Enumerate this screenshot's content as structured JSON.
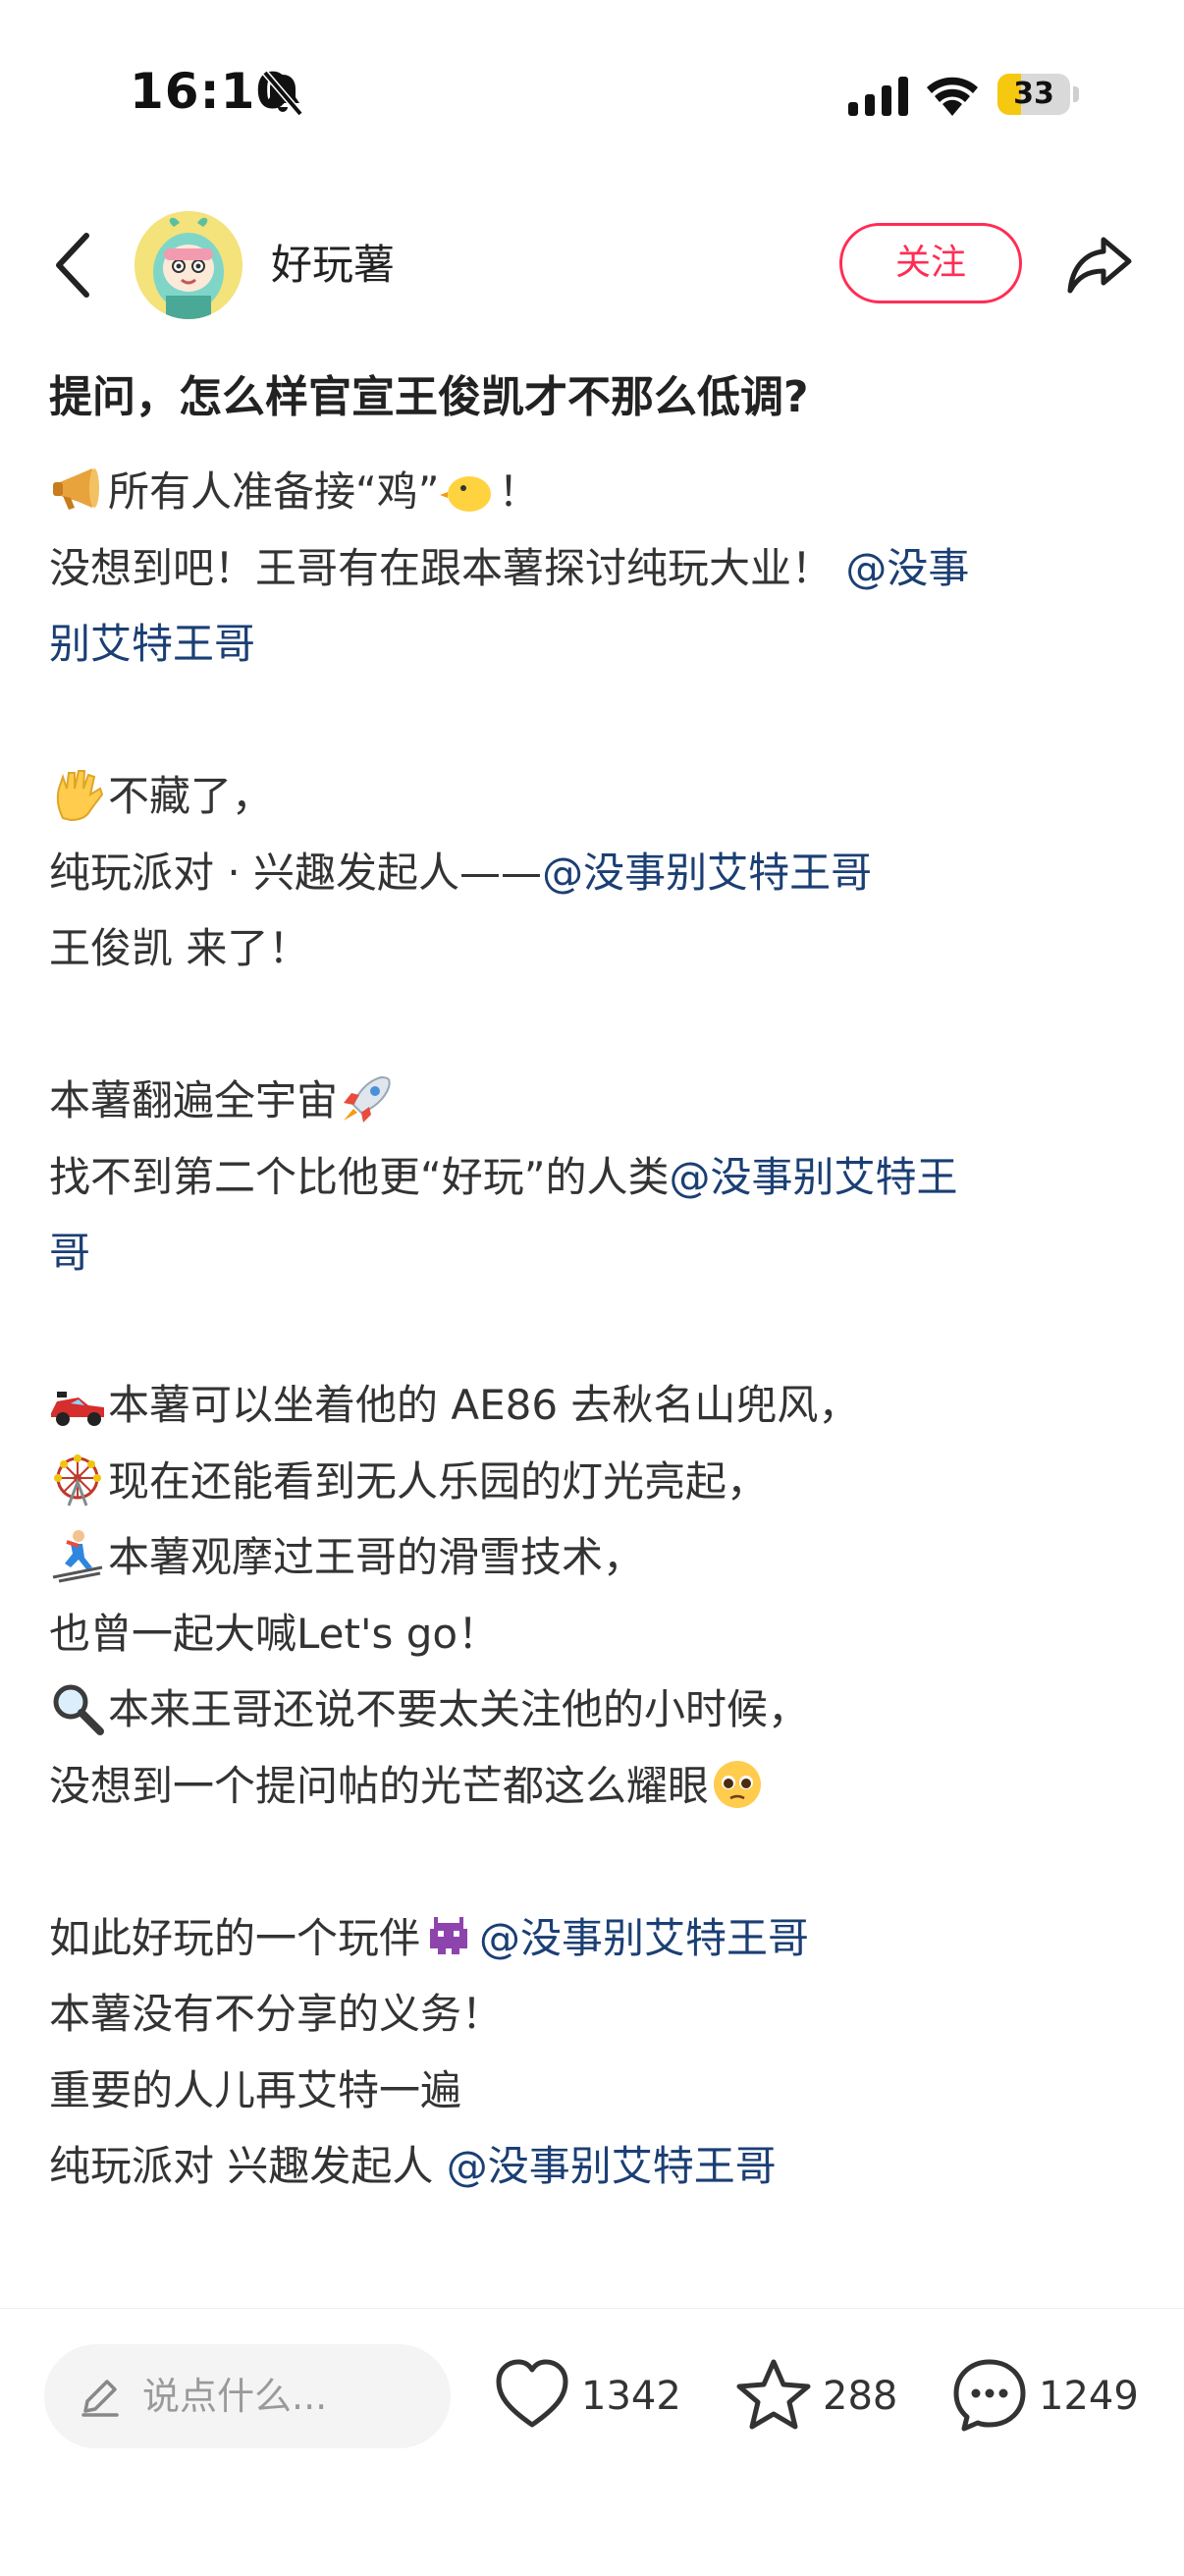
{
  "status_bar": {
    "time": "16:10",
    "battery_level": "33",
    "battery_fraction": 0.33,
    "icons": [
      "bell-off-icon",
      "cellular-signal-icon",
      "wifi-icon",
      "battery-icon"
    ]
  },
  "header": {
    "author_name": "好玩薯",
    "follow_label": "关注",
    "icons": [
      "back-chevron-icon",
      "avatar",
      "share-arrow-icon"
    ]
  },
  "post": {
    "title": "提问，怎么样官宣王俊凯才不那么低调?",
    "lines": [
      {
        "emoji": "megaphone",
        "text": "所有人准备接“鸡”",
        "emoji_after": "baby-chick",
        "after": "！"
      },
      {
        "text": "没想到吧！王哥有在跟本薯探讨纯玩大业！ ",
        "mention": "@没事"
      },
      {
        "mention": "别艾特王哥"
      },
      {
        "blank": true
      },
      {
        "emoji": "raised-hand",
        "text": "不藏了，"
      },
      {
        "text": "纯玩派对 · 兴趣发起人——",
        "mention": "@没事别艾特王哥"
      },
      {
        "text": "王俊凯 来了！"
      },
      {
        "blank": true
      },
      {
        "text": "本薯翻遍全宇宙",
        "emoji_after": "rocket"
      },
      {
        "text": "找不到第二个比他更“好玩”的人类",
        "mention": "@没事别艾特王"
      },
      {
        "mention": "哥"
      },
      {
        "blank": true
      },
      {
        "emoji": "racing-car",
        "text": "本薯可以坐着他的 AE86 去秋名山兜风，"
      },
      {
        "emoji": "ferris-wheel",
        "text": "现在还能看到无人乐园的灯光亮起，"
      },
      {
        "emoji": "skier",
        "text": "本薯观摩过王哥的滑雪技术，"
      },
      {
        "text": "也曾一起大喊Let's go！"
      },
      {
        "emoji": "magnifying-glass",
        "text": "本来王哥还说不要太关注他的小时候，"
      },
      {
        "text": "没想到一个提问帖的光芒都这么耀眼",
        "emoji_after": "pleading-face"
      },
      {
        "blank": true
      },
      {
        "text": "如此好玩的一个玩伴",
        "emoji_after": "alien-monster",
        "mention": "@没事别艾特王哥"
      },
      {
        "text": "本薯没有不分享的义务！"
      },
      {
        "text": "重要的人儿再艾特一遍"
      },
      {
        "text": "纯玩派对 兴趣发起人 ",
        "mention": "@没事别艾特王哥"
      }
    ]
  },
  "bottom_bar": {
    "comment_placeholder": "说点什么...",
    "like_count": "1342",
    "favorite_count": "288",
    "comment_count": "1249"
  }
}
